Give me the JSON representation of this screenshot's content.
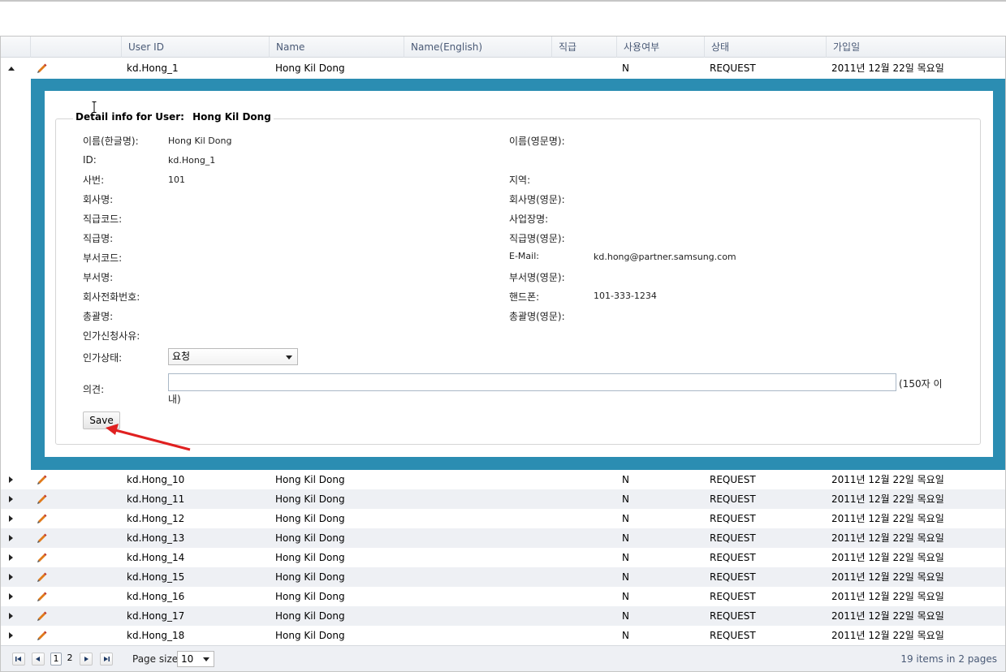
{
  "columns": [
    "User ID",
    "Name",
    "Name(English)",
    "직급",
    "사용여부",
    "상태",
    "가입일"
  ],
  "expanded_row": {
    "user_id": "kd.Hong_1",
    "name": "Hong Kil Dong",
    "use_yn": "N",
    "status": "REQUEST",
    "join_date": "2011년 12월 22일 목요일"
  },
  "detail": {
    "legend_prefix": "Detail info for User:",
    "legend_name": "Hong Kil Dong",
    "left": [
      {
        "label": "이름(한글명):",
        "value": "Hong Kil Dong"
      },
      {
        "label": "ID:",
        "value": "kd.Hong_1"
      },
      {
        "label": "사번:",
        "value": "101"
      },
      {
        "label": "회사명:",
        "value": ""
      },
      {
        "label": "직급코드:",
        "value": ""
      },
      {
        "label": "직급명:",
        "value": ""
      },
      {
        "label": "부서코드:",
        "value": ""
      },
      {
        "label": "부서명:",
        "value": ""
      },
      {
        "label": "회사전화번호:",
        "value": ""
      },
      {
        "label": "총괄명:",
        "value": ""
      },
      {
        "label": "인가신청사유:",
        "value": ""
      }
    ],
    "right": [
      {
        "label": "이름(영문명):",
        "value": ""
      },
      {
        "label": "지역:",
        "value": ""
      },
      {
        "label": "회사명(영문):",
        "value": ""
      },
      {
        "label": "사업장명:",
        "value": ""
      },
      {
        "label": "직급명(영문):",
        "value": ""
      },
      {
        "label": "E-Mail:",
        "value": "kd.hong@partner.samsung.com"
      },
      {
        "label": "부서명(영문):",
        "value": ""
      },
      {
        "label": "핸드폰:",
        "value": "101-333-1234"
      },
      {
        "label": "총괄명(영문):",
        "value": ""
      }
    ],
    "approval_label": "인가상태:",
    "approval_value": "요청",
    "comment_label": "의견:",
    "comment_value": "",
    "comment_hint_line1": "(150자 이",
    "comment_hint_line2": "내)",
    "save_label": "Save"
  },
  "rows": [
    {
      "user_id": "kd.Hong_10",
      "name": "Hong Kil Dong",
      "use_yn": "N",
      "status": "REQUEST",
      "join_date": "2011년 12월 22일 목요일"
    },
    {
      "user_id": "kd.Hong_11",
      "name": "Hong Kil Dong",
      "use_yn": "N",
      "status": "REQUEST",
      "join_date": "2011년 12월 22일 목요일"
    },
    {
      "user_id": "kd.Hong_12",
      "name": "Hong Kil Dong",
      "use_yn": "N",
      "status": "REQUEST",
      "join_date": "2011년 12월 22일 목요일"
    },
    {
      "user_id": "kd.Hong_13",
      "name": "Hong Kil Dong",
      "use_yn": "N",
      "status": "REQUEST",
      "join_date": "2011년 12월 22일 목요일"
    },
    {
      "user_id": "kd.Hong_14",
      "name": "Hong Kil Dong",
      "use_yn": "N",
      "status": "REQUEST",
      "join_date": "2011년 12월 22일 목요일"
    },
    {
      "user_id": "kd.Hong_15",
      "name": "Hong Kil Dong",
      "use_yn": "N",
      "status": "REQUEST",
      "join_date": "2011년 12월 22일 목요일"
    },
    {
      "user_id": "kd.Hong_16",
      "name": "Hong Kil Dong",
      "use_yn": "N",
      "status": "REQUEST",
      "join_date": "2011년 12월 22일 목요일"
    },
    {
      "user_id": "kd.Hong_17",
      "name": "Hong Kil Dong",
      "use_yn": "N",
      "status": "REQUEST",
      "join_date": "2011년 12월 22일 목요일"
    },
    {
      "user_id": "kd.Hong_18",
      "name": "Hong Kil Dong",
      "use_yn": "N",
      "status": "REQUEST",
      "join_date": "2011년 12월 22일 목요일"
    }
  ],
  "pager": {
    "pages": [
      "1",
      "2"
    ],
    "current_page": "1",
    "page_size_label": "Page size:",
    "page_size_value": "10",
    "summary": "19 items in 2 pages"
  },
  "icons": {
    "expander_open": "triangle-down-icon",
    "expander_closed": "triangle-right-icon",
    "edit": "pencil-icon",
    "pager_first": "first-page-icon",
    "pager_prev": "previous-page-icon",
    "pager_next": "next-page-icon",
    "pager_last": "last-page-icon"
  },
  "colors": {
    "detail_frame": "#2b8db2",
    "alt_row": "#eef0f4",
    "header_text": "#4a5a76",
    "annotation_arrow": "#e02020",
    "pencil": "#e07a1a"
  }
}
